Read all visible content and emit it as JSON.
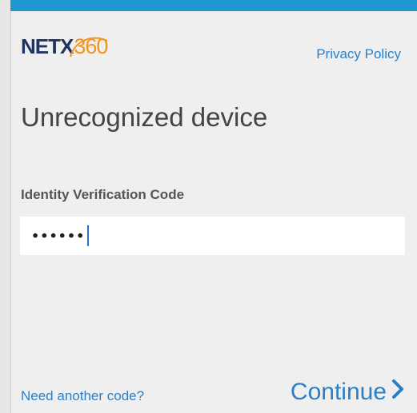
{
  "brand": {
    "logo_text_netx": "NETX",
    "logo_text_360": "360",
    "colors": {
      "netx": "#1f3560",
      "accent_orange": "#f3941f",
      "top_bar": "#2196d3",
      "link": "#2a7fc7"
    }
  },
  "header": {
    "privacy_link": "Privacy Policy"
  },
  "main": {
    "title": "Unrecognized device",
    "field_label": "Identity Verification Code",
    "code_value": "••••••"
  },
  "footer": {
    "need_code_link": "Need another code?",
    "continue_label": "Continue",
    "continue_icon": "chevron-right-icon"
  }
}
